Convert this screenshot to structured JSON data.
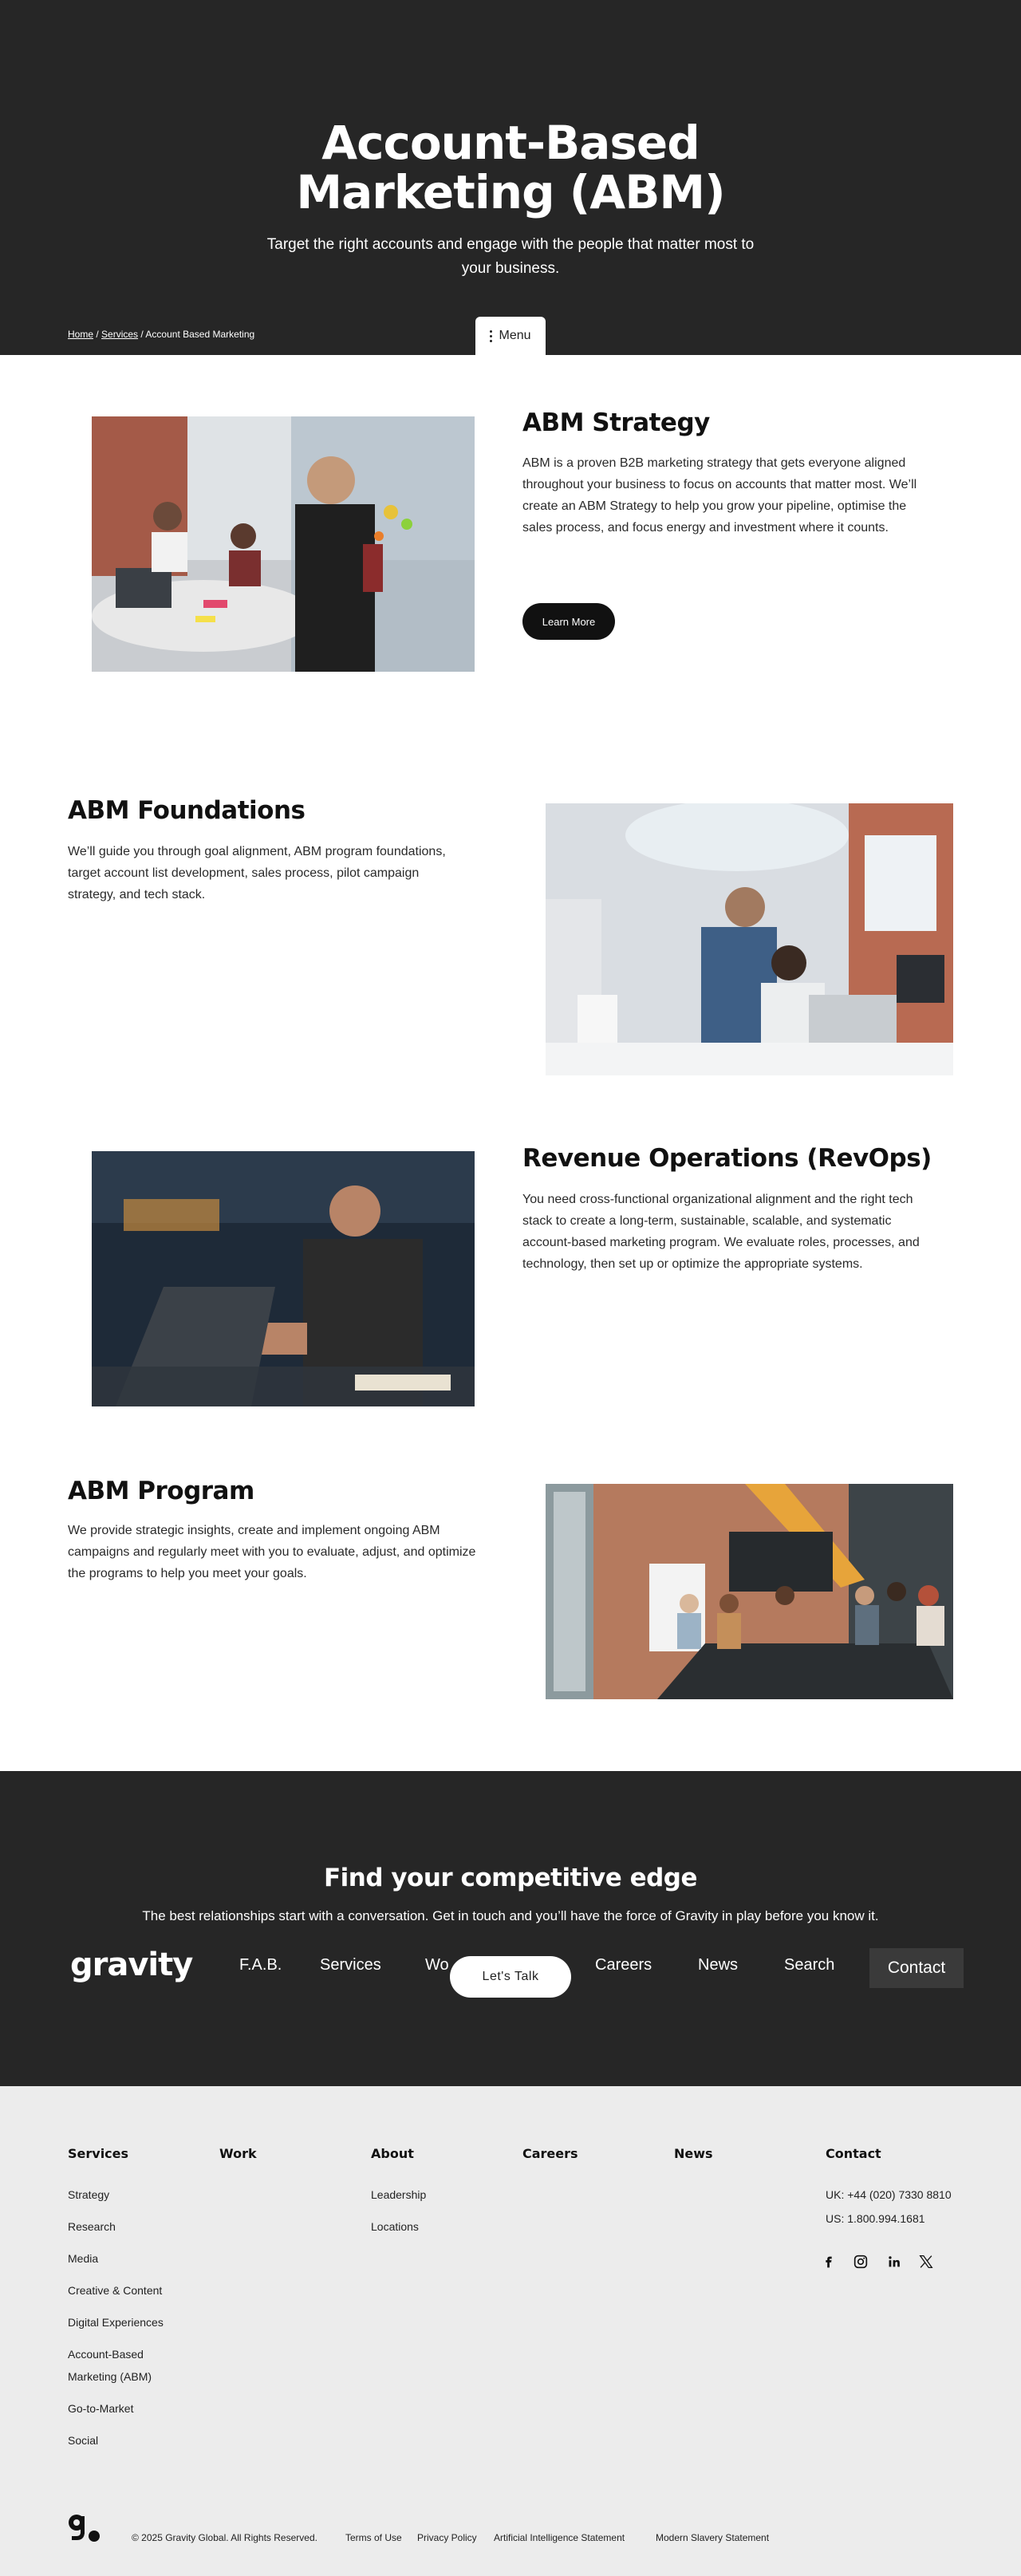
{
  "hero": {
    "title_line1": "Account-Based",
    "title_line2": "Marketing (ABM)",
    "subtitle": "Target the right accounts and engage with the people that matter most to your business.",
    "breadcrumb": {
      "home": "Home",
      "sep1": "/",
      "services": "Services",
      "sep2": "/",
      "current": "Account Based Marketing"
    },
    "menu_label": "Menu"
  },
  "sections": [
    {
      "title": "ABM Strategy",
      "body": "ABM is a proven B2B marketing strategy that gets everyone aligned throughout your business to focus on accounts that matter most. We’ll create an ABM Strategy to help you grow your pipeline, optimise the sales process, and focus energy and investment where it counts.",
      "button": "Learn More"
    },
    {
      "title": "ABM Foundations",
      "body": "We’ll guide you through goal alignment, ABM program foundations, target account list development, sales process, pilot campaign strategy, and tech stack."
    },
    {
      "title": "Revenue Operations (RevOps)",
      "body": "You need cross-functional organizational alignment and the right tech stack to create a long-term, sustainable, scalable, and systematic account-based marketing program. We evaluate roles, processes, and technology, then set up or optimize the appropriate systems."
    },
    {
      "title": "ABM Program",
      "body": "We provide strategic insights, create and implement ongoing ABM campaigns and regularly meet with you to evaluate, adjust, and optimize the programs to help you meet your goals."
    }
  ],
  "cta": {
    "title": "Find your competitive edge",
    "subtitle": "The best relationships start with a conversation. Get in touch and you’ll have the force of Gravity in play before you know it.",
    "logo": "gravity",
    "nav": [
      "F.A.B.",
      "Services",
      "Wo",
      "Careers",
      "News",
      "Search"
    ],
    "contact": "Contact",
    "lets_talk": "Let's Talk"
  },
  "footer": {
    "columns": [
      {
        "heading": "Services",
        "links": [
          "Strategy",
          "Research",
          "Media",
          "Creative & Content",
          "Digital Experiences",
          "Account-Based",
          "Marketing (ABM)",
          "Go-to-Market",
          "Social"
        ]
      },
      {
        "heading": "Work",
        "links": []
      },
      {
        "heading": "About",
        "links": [
          "Leadership",
          "Locations"
        ]
      },
      {
        "heading": "Careers",
        "links": []
      },
      {
        "heading": "News",
        "links": []
      },
      {
        "heading": "Contact",
        "links": [
          "UK: +44 (020) 7330 8810",
          "US: 1.800.994.1681"
        ]
      }
    ],
    "social": [
      "facebook-icon",
      "instagram-icon",
      "linkedin-icon",
      "x-icon"
    ],
    "copyright": "© 2025 Gravity Global. All Rights Reserved.",
    "legal": [
      "Terms of Use",
      "Privacy Policy",
      "Artificial Intelligence Statement",
      "Modern Slavery Statement"
    ]
  },
  "colors": {
    "dark_band": "#262626",
    "footer_bg": "#ececec",
    "accent_black": "#111111"
  }
}
